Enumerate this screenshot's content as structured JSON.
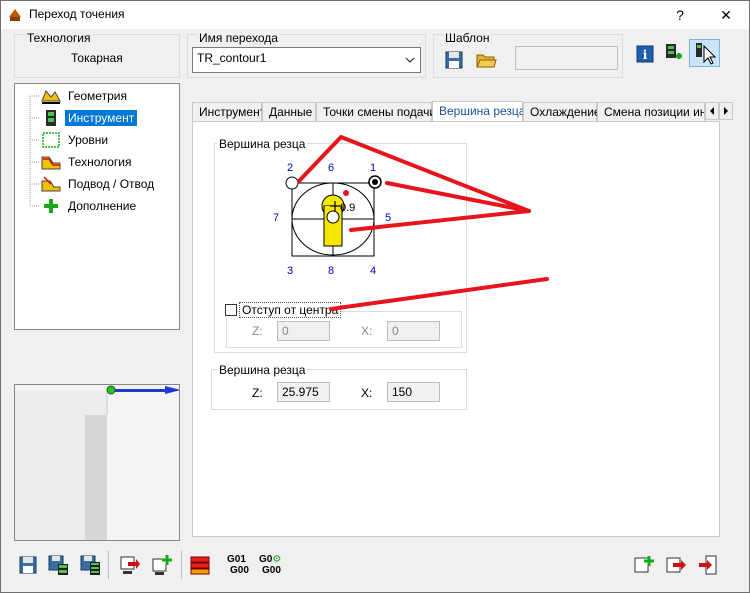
{
  "window": {
    "title": "Переход точения",
    "help": "?",
    "close": "✕"
  },
  "technology": {
    "label": "Технология",
    "value": "Токарная"
  },
  "transition_name": {
    "label": "Имя перехода",
    "value": "TR_contour1"
  },
  "template": {
    "label": "Шаблон",
    "value": ""
  },
  "tree": {
    "items": [
      {
        "label": "Геометрия",
        "selected": false
      },
      {
        "label": "Инструмент",
        "selected": true
      },
      {
        "label": "Уровни",
        "selected": false
      },
      {
        "label": "Технология",
        "selected": false
      },
      {
        "label": "Подвод / Отвод",
        "selected": false
      },
      {
        "label": "Дополнение",
        "selected": false
      }
    ]
  },
  "tabs": [
    {
      "label": "Инструмент",
      "active": false
    },
    {
      "label": "Данные",
      "active": false
    },
    {
      "label": "Точки смены подачи",
      "active": false
    },
    {
      "label": "Вершина резца",
      "active": true
    },
    {
      "label": "Охлаждение",
      "active": false
    },
    {
      "label": "Смена позиции инс",
      "active": false
    }
  ],
  "tip_group": {
    "title": "Вершина резца",
    "positions": [
      "2",
      "6",
      "1",
      "7",
      "5",
      "3",
      "8",
      "4"
    ],
    "radius": "0.9"
  },
  "offset": {
    "checkbox_label": "Отступ от центра",
    "z_label": "Z:",
    "z_value": "0",
    "x_label": "X:",
    "x_value": "0"
  },
  "tip_coords": {
    "title": "Вершина резца",
    "z_label": "Z:",
    "z_value": "25.975",
    "x_label": "X:",
    "x_value": "150"
  },
  "bottom": {
    "g01": "G01",
    "g00a": "G00",
    "g0b": "G0",
    "g00b": "G00"
  },
  "colors": {
    "accent": "#0078d7",
    "annotation": "#e8141c",
    "tip": "#f5e800"
  }
}
